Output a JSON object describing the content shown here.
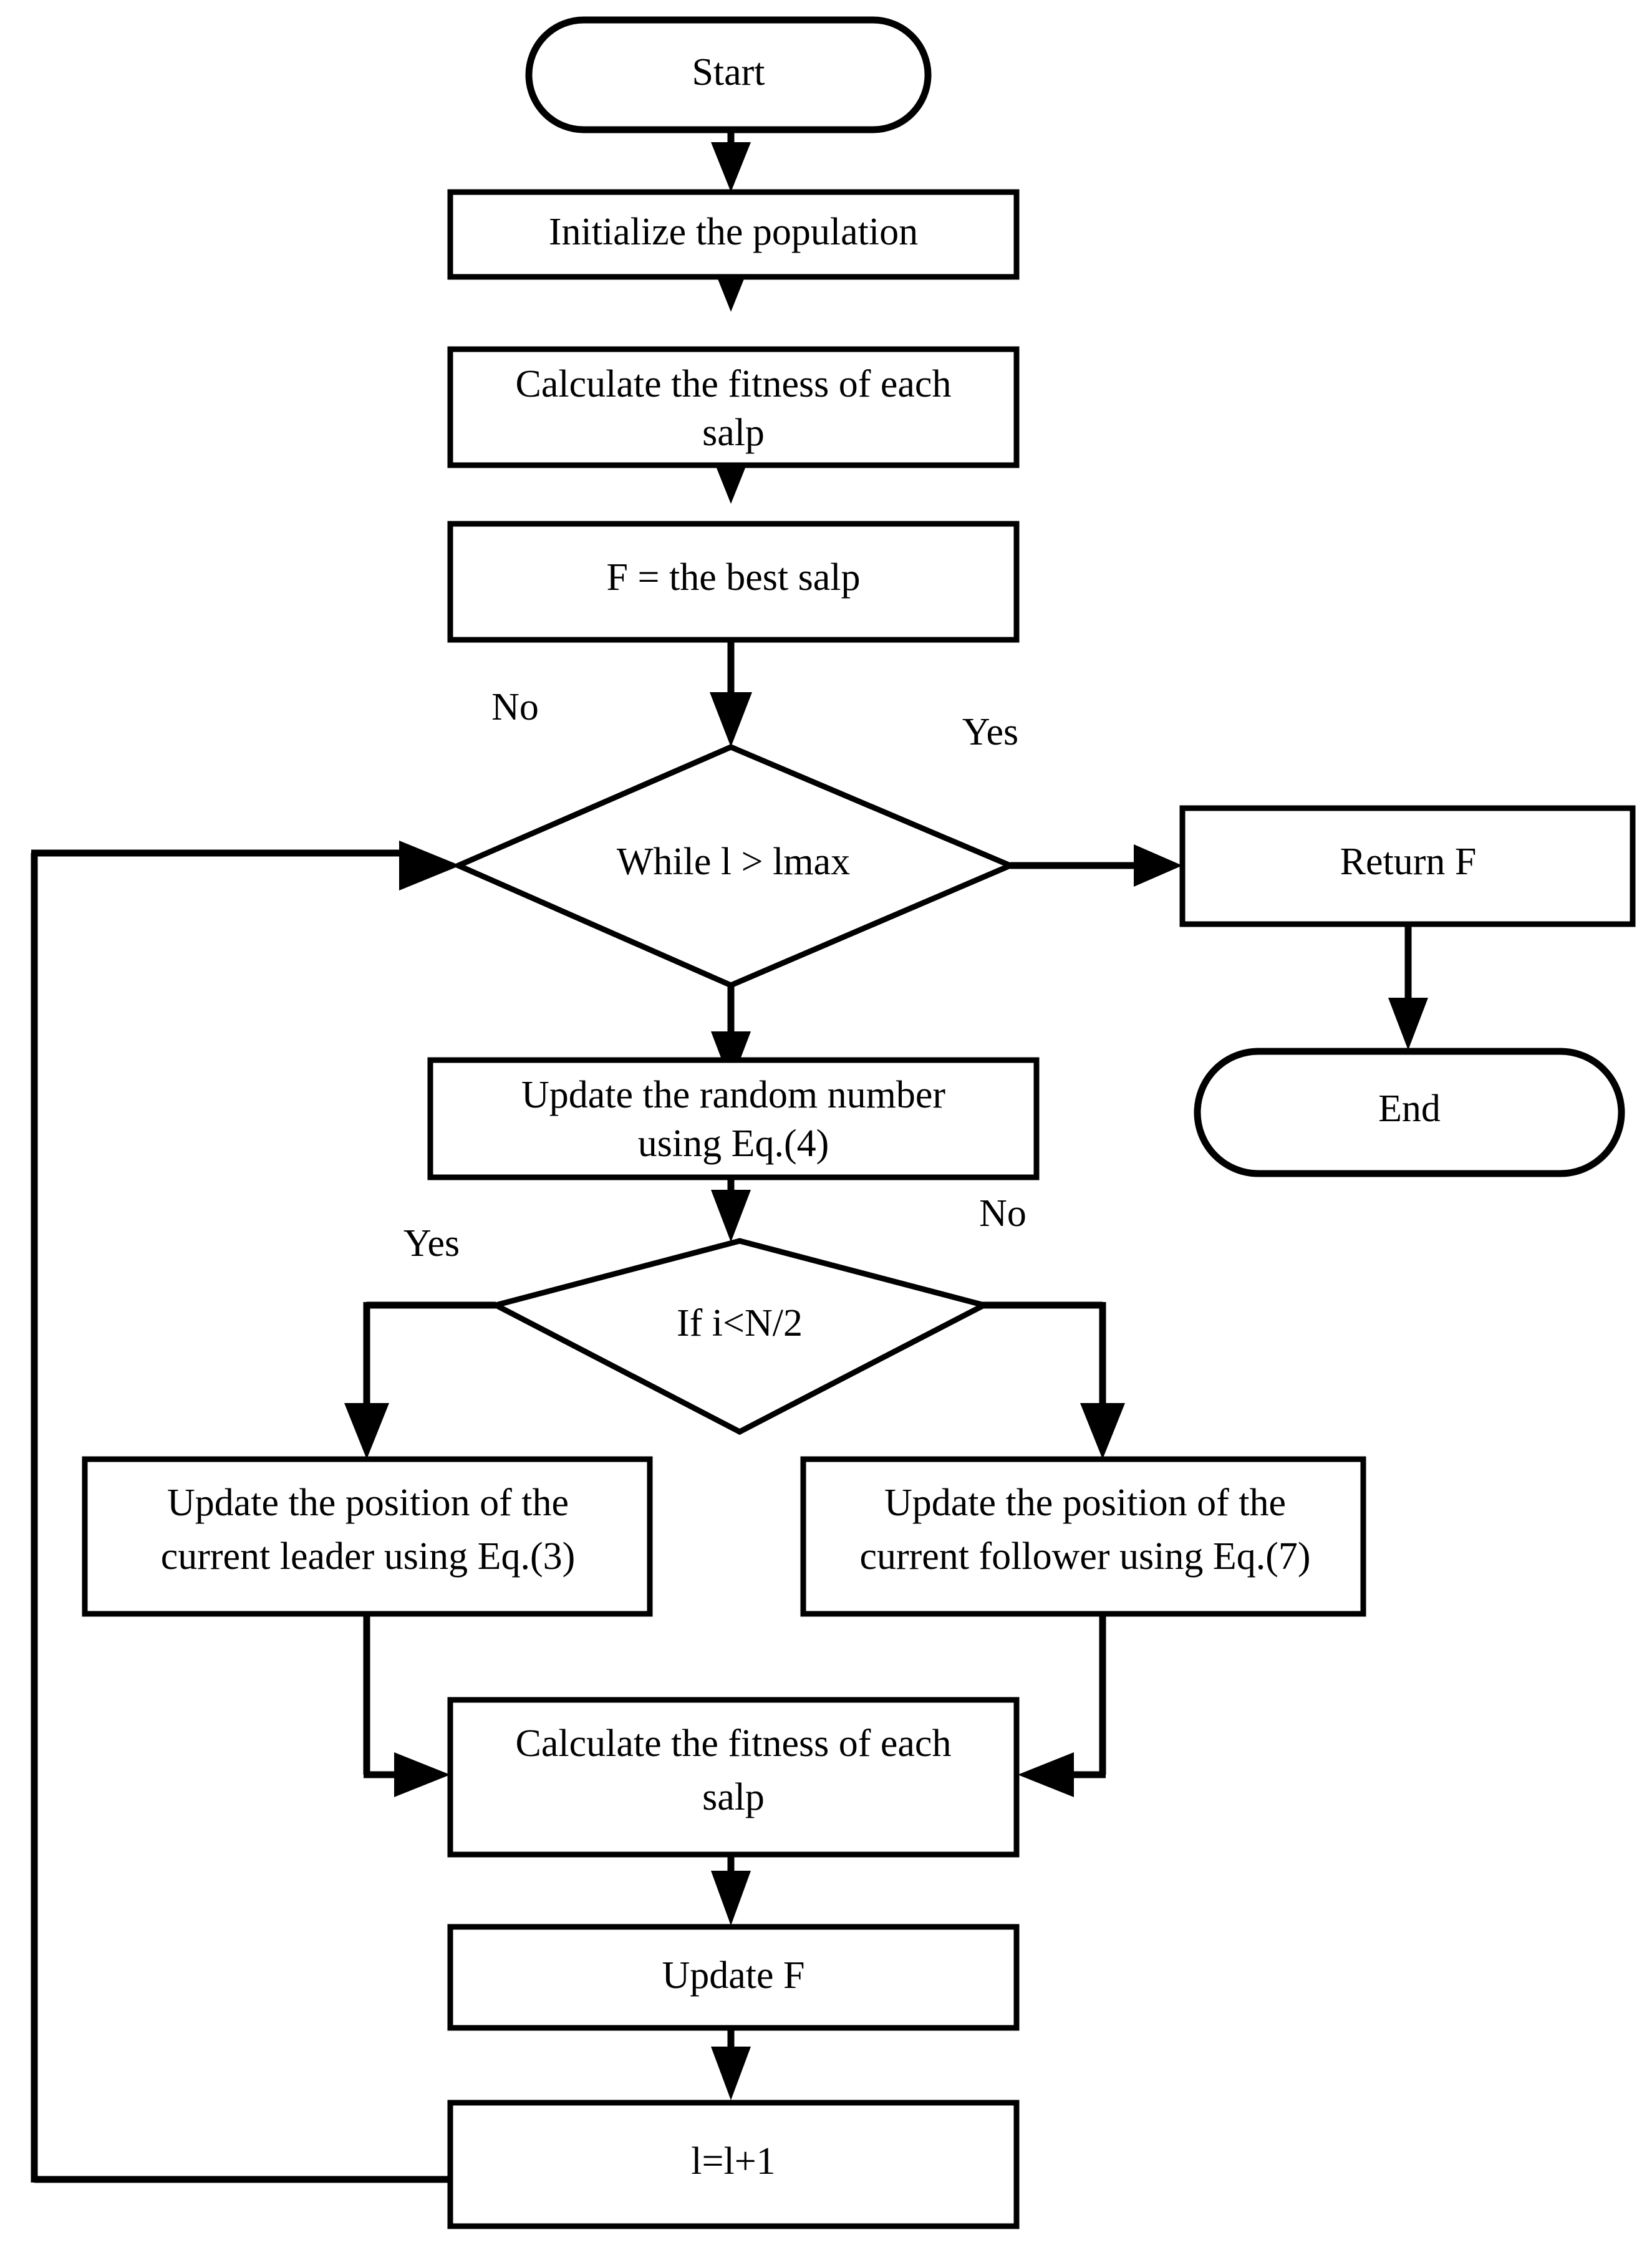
{
  "diagram": {
    "title": "Salp Swarm Algorithm flowchart",
    "stroke_color": "#000000",
    "fill_color": "#ffffff",
    "nodes": {
      "start": {
        "label": "Start",
        "shape": "terminator"
      },
      "init_population": {
        "label": "Initialize the population",
        "shape": "process"
      },
      "calc_fitness_1": {
        "label_line1": "Calculate the fitness of each",
        "label_line2": "salp",
        "shape": "process"
      },
      "best_salp": {
        "label": "F = the best salp",
        "shape": "process"
      },
      "while_decision": {
        "label": "While l > lmax",
        "shape": "decision"
      },
      "return_f": {
        "label": "Return F",
        "shape": "process"
      },
      "end": {
        "label": "End",
        "shape": "terminator"
      },
      "update_random": {
        "label_line1": "Update the random number",
        "label_line2": "using Eq.(4)",
        "shape": "process"
      },
      "if_decision": {
        "label": "If i<N/2",
        "shape": "decision"
      },
      "update_leader": {
        "label_line1": "Update the position of the",
        "label_line2": "current leader using Eq.(3)",
        "shape": "process"
      },
      "update_follower": {
        "label_line1": "Update the position of the",
        "label_line2": "current follower using Eq.(7)",
        "shape": "process"
      },
      "calc_fitness_2": {
        "label_line1": "Calculate the fitness of each",
        "label_line2": "salp",
        "shape": "process"
      },
      "update_f": {
        "label": "Update F",
        "shape": "process"
      },
      "increment_l": {
        "label": "l=l+1",
        "shape": "process"
      }
    },
    "branch_labels": {
      "while_no": "No",
      "while_yes": "Yes",
      "if_yes": "Yes",
      "if_no": "No"
    }
  }
}
